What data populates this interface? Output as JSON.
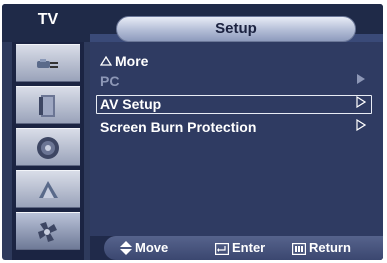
{
  "header": {
    "source_label": "TV",
    "title": "Setup"
  },
  "sidebar": {
    "items": [
      {
        "icon": "input-plug-icon",
        "active": false
      },
      {
        "icon": "picture-screen-icon",
        "active": false
      },
      {
        "icon": "sound-speaker-icon",
        "active": false
      },
      {
        "icon": "channel-dish-icon",
        "active": false
      },
      {
        "icon": "setup-tools-icon",
        "active": true
      }
    ]
  },
  "menu": {
    "items": [
      {
        "label": "More",
        "icon": "up-triangle-icon",
        "state": "normal",
        "has_submenu": false
      },
      {
        "label": "PC",
        "state": "disabled",
        "has_submenu": true
      },
      {
        "label": "AV Setup",
        "state": "selected",
        "has_submenu": true
      },
      {
        "label": "Screen Burn Protection",
        "state": "normal",
        "has_submenu": true
      }
    ]
  },
  "footer": {
    "move_label": "Move",
    "enter_label": "Enter",
    "return_label": "Return"
  },
  "colors": {
    "panel_bg": "#2f3b62",
    "sidebar_bg": "#1b2442",
    "title_pill": "#b3bdd6",
    "disabled_text": "#8d97b6"
  }
}
